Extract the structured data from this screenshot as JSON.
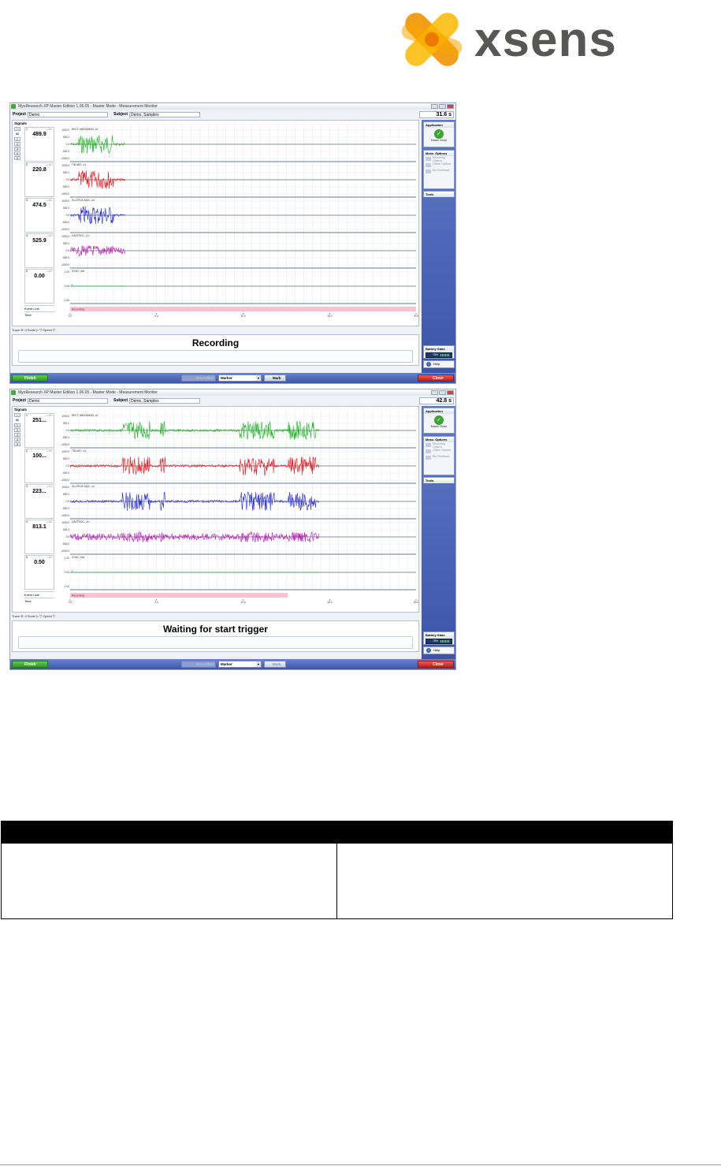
{
  "logo": {
    "wordmark": "xsens",
    "colors": {
      "orange": "#f29400",
      "yellow": "#fbb900",
      "text": "#575756"
    }
  },
  "screenshots": [
    {
      "title": "MyoResearch XP Master Edition 1.06.05 - Master Mode - Measurement Monitor",
      "project_label": "Project",
      "project_value": "Demo",
      "subject_label": "Subject",
      "subject_value": "Demo, Samples",
      "elapsed_time": "31.6 s",
      "signals_title": "Signals",
      "select_all": "All",
      "channel_buttons": [
        "1",
        "2",
        "3",
        "4",
        "5"
      ],
      "channels": [
        {
          "num": "1",
          "value": "489.9",
          "name": "RECT. ABDOMINIS, uV",
          "color": "#19b31e",
          "yticks": [
            "1000.0",
            "500.0",
            "0.0",
            "-500.0",
            "-1000.0"
          ]
        },
        {
          "num": "2",
          "value": "220.8",
          "name": "TIB.ANT., uV",
          "color": "#e3151b",
          "yticks": [
            "1000.0",
            "500.0",
            "0.0",
            "-500.0",
            "-1000.0"
          ]
        },
        {
          "num": "3",
          "value": "474.5",
          "name": "GLUTEUS MAX., uV",
          "color": "#2124d4",
          "yticks": [
            "1000.0",
            "500.0",
            "0.0",
            "-500.0",
            "-1000.0"
          ]
        },
        {
          "num": "4",
          "value": "525.9",
          "name": "GASTROC., uV",
          "color": "#b81bb3",
          "yticks": [
            "1000.0",
            "500.0",
            "0.0",
            "-500.0",
            "-1000.0"
          ]
        },
        {
          "num": "5",
          "value": "0.00",
          "name": "SYNC, Volt",
          "color": "#19b31e",
          "yticks": [
            "1.00",
            "0.00",
            "-1.00"
          ]
        }
      ],
      "event_line_label": "Event Line",
      "event_text": "Recording",
      "time_label": "Time",
      "x_ticks": [
        "0.0",
        "5.0",
        "10.0",
        "15.0",
        "20.0"
      ],
      "zoom_bar": "Trace ⊕   ◁ Scale ▷   ▽ Speed ▽",
      "status_text": "Recording",
      "sidebar": {
        "application_title": "Application",
        "application_caption": "Master Mode",
        "options_title": "Meas. Options",
        "options_items": [
          "Recording Options",
          "Online Options",
          "Bio Feedback"
        ],
        "tools_title": "Tools",
        "battery_title": "Battery State",
        "battery_value": "75%",
        "help_label": "Help"
      },
      "buttons": {
        "finish": "Finish",
        "zero_offset": "Zero Offset",
        "marker": "Marker",
        "mark": "Mark",
        "close": "Close"
      }
    },
    {
      "title": "MyoResearch XP Master Edition 1.06.05 - Master Mode - Measurement Monitor",
      "project_label": "Project",
      "project_value": "Demo",
      "subject_label": "Subject",
      "subject_value": "Demo, Samples",
      "elapsed_time": "42.8 s",
      "signals_title": "Signals",
      "select_all": "All",
      "channel_buttons": [
        "1",
        "2",
        "3",
        "4",
        "5"
      ],
      "channels": [
        {
          "num": "1",
          "value": "251...",
          "name": "RECT. ABDOMINIS, uV",
          "color": "#19b31e",
          "yticks": [
            "1000.0",
            "500.0",
            "0.0",
            "-500.0",
            "-1000.0"
          ]
        },
        {
          "num": "2",
          "value": "100...",
          "name": "TIB.ANT., uV",
          "color": "#e3151b",
          "yticks": [
            "1000.0",
            "500.0",
            "0.0",
            "-500.0",
            "-1000.0"
          ]
        },
        {
          "num": "3",
          "value": "223...",
          "name": "GLUTEUS MAX., uV",
          "color": "#2124d4",
          "yticks": [
            "1000.0",
            "500.0",
            "0.0",
            "-500.0",
            "-1000.0"
          ]
        },
        {
          "num": "4",
          "value": "813.1",
          "name": "GASTROC., uV",
          "color": "#b81bb3",
          "yticks": [
            "1000.0",
            "500.0",
            "0.0",
            "-500.0",
            "-1000.0"
          ]
        },
        {
          "num": "5",
          "value": "0.50",
          "name": "SYNC, Volt",
          "color": "#19b31e",
          "yticks": [
            "1.00",
            "0.00",
            "-1.00"
          ]
        }
      ],
      "event_line_label": "Event Line",
      "event_text": "Recording",
      "time_label": "Time",
      "x_ticks": [
        "0.0",
        "5.0",
        "10.0",
        "15.0",
        "20.0"
      ],
      "zoom_bar": "Trace ⊕   ◁ Scale ▷   ▽ Speed ▽",
      "status_text": "Waiting for start trigger",
      "sidebar": {
        "application_title": "Application",
        "application_caption": "Master Mode",
        "options_title": "Meas. Options",
        "options_items": [
          "Recording Options",
          "Online Options",
          "Bio Feedback"
        ],
        "tools_title": "Tools",
        "battery_title": "Battery State",
        "battery_value": "75%",
        "help_label": "Help"
      },
      "buttons": {
        "finish": "Finish",
        "zero_offset": "Zero Offset",
        "marker": "Marker",
        "mark": "Mark",
        "close": "Close"
      }
    }
  ],
  "traces": [
    {
      "recorded_until_s": 3.2,
      "recording_event_until_s": 20.0,
      "bursts": [
        [
          0.5,
          2.5
        ]
      ]
    },
    {
      "recorded_until_s": 14.4,
      "recording_event_until_s": 12.6,
      "bursts": [
        [
          3.0,
          4.6
        ],
        [
          5.2,
          5.5
        ],
        [
          9.8,
          11.8
        ],
        [
          12.6,
          14.2
        ]
      ]
    }
  ],
  "footer_rule_color": "#e48d3c"
}
